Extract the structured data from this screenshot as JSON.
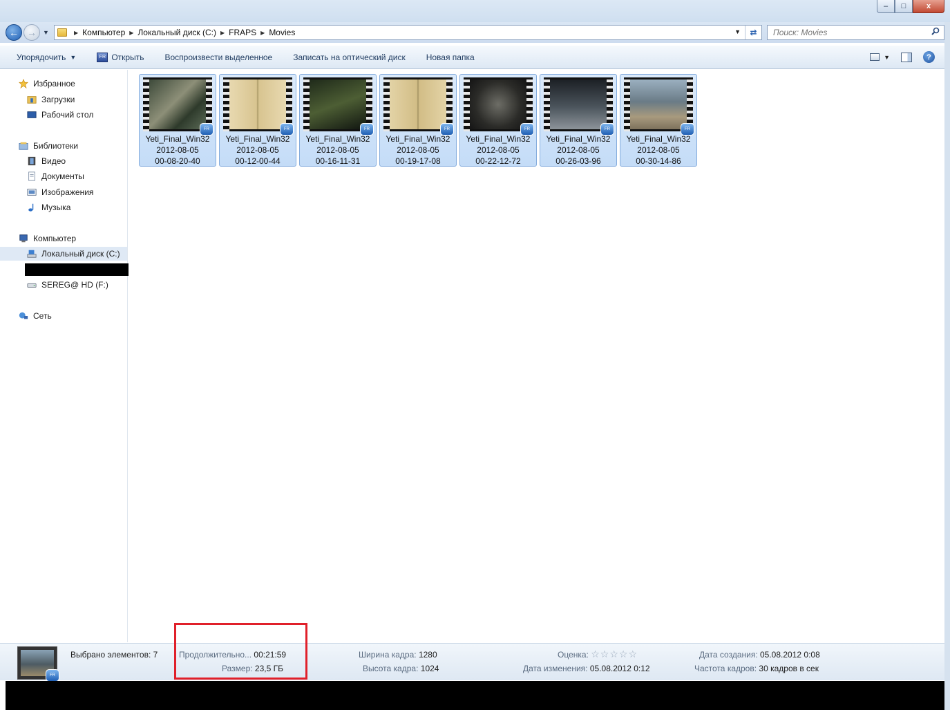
{
  "window": {
    "caption_min": "–",
    "caption_max": "□",
    "caption_close": "x"
  },
  "address": {
    "crumbs": [
      "Компьютер",
      "Локальный диск (C:)",
      "FRAPS",
      "Movies"
    ],
    "search_placeholder": "Поиск: Movies"
  },
  "toolbar": {
    "organize": "Упорядочить",
    "open": "Открыть",
    "play_selected": "Воспроизвести выделенное",
    "burn": "Записать на оптический диск",
    "new_folder": "Новая папка"
  },
  "nav": {
    "favorites": "Избранное",
    "downloads": "Загрузки",
    "desktop": "Рабочий стол",
    "libraries": "Библиотеки",
    "video": "Видео",
    "documents": "Документы",
    "images": "Изображения",
    "music": "Музыка",
    "computer": "Компьютер",
    "local_disk": "Локальный диск (C:)",
    "hd_f": "SEREG@ HD (F:)",
    "network": "Сеть"
  },
  "files": [
    {
      "name": "Yeti_Final_Win32",
      "date": "2012-08-05",
      "time": "00-08-20-40"
    },
    {
      "name": "Yeti_Final_Win32",
      "date": "2012-08-05",
      "time": "00-12-00-44"
    },
    {
      "name": "Yeti_Final_Win32",
      "date": "2012-08-05",
      "time": "00-16-11-31"
    },
    {
      "name": "Yeti_Final_Win32",
      "date": "2012-08-05",
      "time": "00-19-17-08"
    },
    {
      "name": "Yeti_Final_Win32",
      "date": "2012-08-05",
      "time": "00-22-12-72"
    },
    {
      "name": "Yeti_Final_Win32",
      "date": "2012-08-05",
      "time": "00-26-03-96"
    },
    {
      "name": "Yeti_Final_Win32",
      "date": "2012-08-05",
      "time": "00-30-14-86"
    }
  ],
  "details": {
    "selected": "Выбрано элементов: 7",
    "duration_label": "Продолжительно...",
    "duration_value": "00:21:59",
    "size_label": "Размер:",
    "size_value": "23,5 ГБ",
    "width_label": "Ширина кадра:",
    "width_value": "1280",
    "height_label": "Высота кадра:",
    "height_value": "1024",
    "rating_label": "Оценка:",
    "rating_stars": "☆☆☆☆☆",
    "modified_label": "Дата изменения:",
    "modified_value": "05.08.2012 0:12",
    "created_label": "Дата создания:",
    "created_value": "05.08.2012 0:08",
    "fps_label": "Частота кадров:",
    "fps_value": "30 кадров в сек"
  },
  "colors": {
    "accent": "#1f5fb4",
    "selection": "#c4dcf7",
    "highlight_box": "#e0202a"
  }
}
